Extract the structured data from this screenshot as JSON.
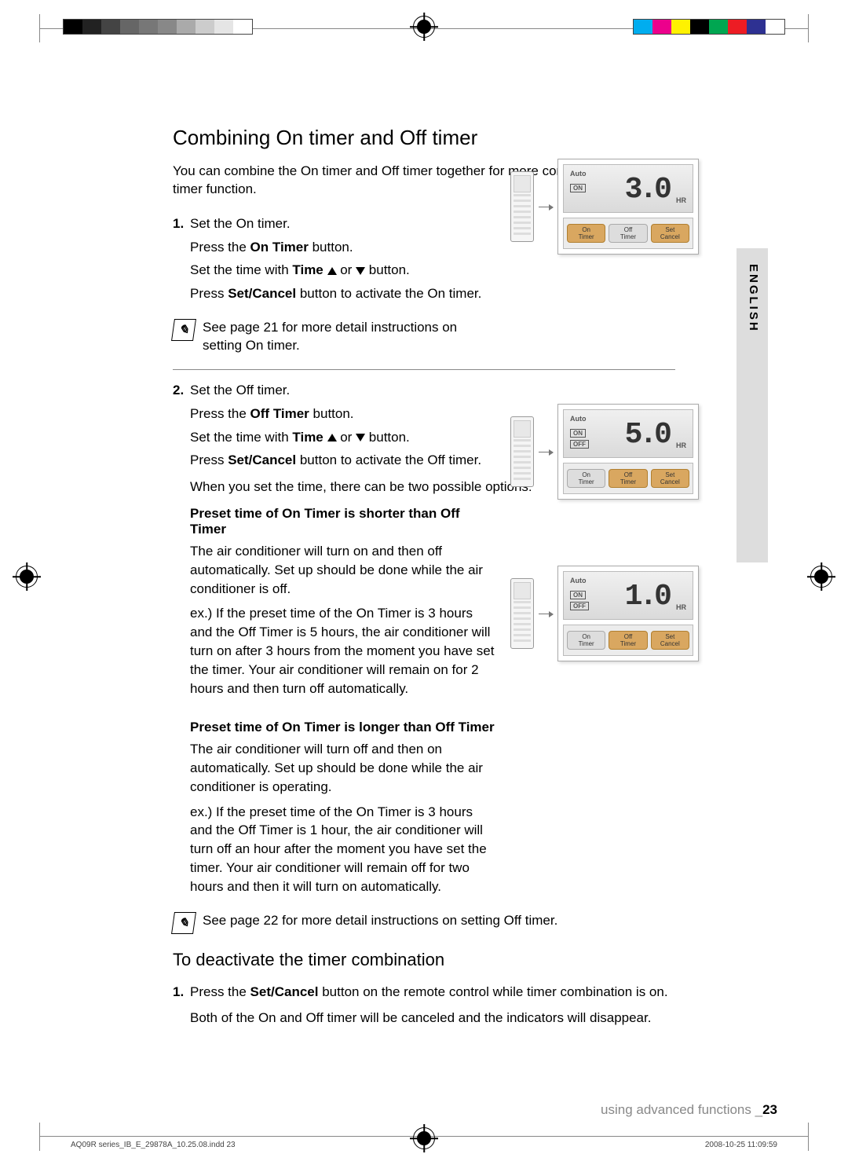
{
  "lang_tab": "ENGLISH",
  "heading": "Combining On timer and Off timer",
  "intro": "You can combine the On timer and Off timer together for more convenient use of the timer function.",
  "step1": {
    "num": "1.",
    "l1": "Set the On timer.",
    "l2a": "Press the ",
    "l2b": "On Timer",
    "l2c": " button.",
    "l3a": "Set the time with ",
    "l3b": "Time",
    "l3d": " or ",
    "l3f": " button.",
    "l4a": "Press ",
    "l4b": "Set/Cancel",
    "l4c": " button to activate the On timer."
  },
  "note1": "See page 21 for more detail instructions on setting On timer.",
  "step2": {
    "num": "2.",
    "l1": "Set the Off timer.",
    "l2a": "Press the ",
    "l2b": "Off Timer",
    "l2c": " button.",
    "l3a": "Set the time with ",
    "l3b": "Time",
    "l3d": " or ",
    "l3f": " button.",
    "l4a": "Press ",
    "l4b": "Set/Cancel",
    "l4c": " button to activate the Off timer."
  },
  "options_intro": "When you set the time, there can be two possible options:",
  "optA": {
    "title": "Preset time of On Timer is shorter than Off Timer",
    "p1": "The air conditioner will turn on and then off automatically. Set up should be done while the air conditioner is off.",
    "p2": "ex.) If the preset time of the On Timer is 3 hours and the Off Timer is 5 hours, the air conditioner will turn on after 3 hours from the moment you have set the timer. Your air conditioner will remain on for 2 hours and then turn off automatically."
  },
  "optB": {
    "title": "Preset time of On Timer is longer than Off Timer",
    "p1": "The air conditioner will turn off and then on automatically. Set up should be done while the air conditioner is operating.",
    "p2": "ex.) If the preset time of the On Timer is 3 hours and the Off Timer is 1 hour, the air conditioner will turn off an hour after the moment you have set the timer. Your air conditioner will remain off for two hours and then it will turn on automatically."
  },
  "note2": "See page 22 for more detail instructions on setting Off timer.",
  "h3": "To deactivate the timer combination",
  "deact": {
    "num": "1.",
    "l1a": "Press the ",
    "l1b": "Set/Cancel",
    "l1c": " button on the remote control while timer combination is on.",
    "l2": "Both of the On and Off timer will be canceled and the indicators will disappear."
  },
  "footer_text": "using advanced functions _",
  "footer_page": "23",
  "meta_left": "AQ09R series_IB_E_29878A_10.25.08.indd   23",
  "meta_right": "2008-10-25   11:09:59",
  "lcd": {
    "auto": "Auto",
    "on": "ON",
    "off": "OFF",
    "hr": "HR",
    "d1": "3.0",
    "d2": "5.0",
    "d3": "1.0",
    "btn_on": "On\nTimer",
    "btn_off": "Off\nTimer",
    "btn_set": "Set\nCancel"
  }
}
